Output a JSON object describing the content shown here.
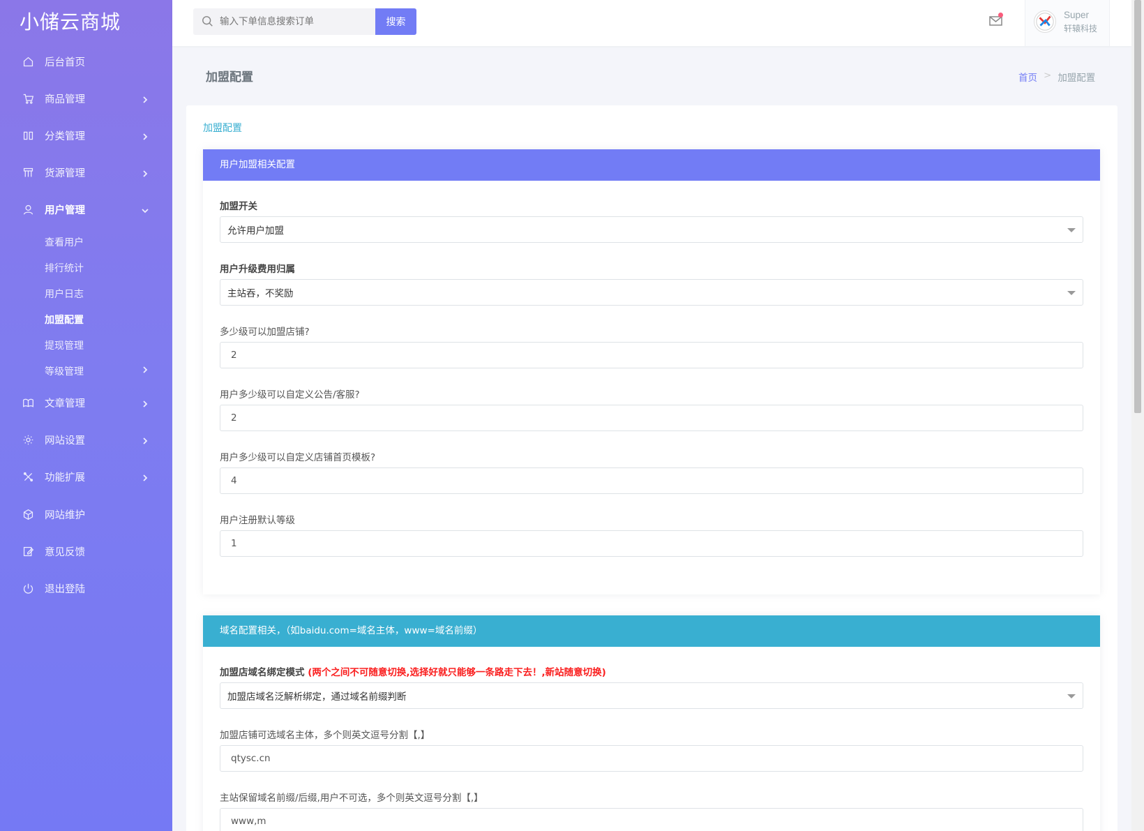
{
  "app": {
    "brand": "小储云商城"
  },
  "sidebar": {
    "items": [
      {
        "label": "后台首页",
        "icon": "home-icon"
      },
      {
        "label": "商品管理",
        "icon": "cart-icon"
      },
      {
        "label": "分类管理",
        "icon": "columns-icon"
      },
      {
        "label": "货源管理",
        "icon": "grid-icon"
      },
      {
        "label": "用户管理",
        "icon": "user-icon"
      },
      {
        "label": "文章管理",
        "icon": "book-icon"
      },
      {
        "label": "网站设置",
        "icon": "gear-icon"
      },
      {
        "label": "功能扩展",
        "icon": "tools-icon"
      },
      {
        "label": "网站维护",
        "icon": "cube-icon"
      },
      {
        "label": "意见反馈",
        "icon": "edit-icon"
      },
      {
        "label": "退出登陆",
        "icon": "power-icon"
      }
    ],
    "subitems": [
      "查看用户",
      "排行统计",
      "用户日志",
      "加盟配置",
      "提现管理",
      "等级管理"
    ]
  },
  "topbar": {
    "search_placeholder": "输入下单信息搜索订单",
    "search_button": "搜索",
    "user_name": "Super",
    "user_org": "轩辕科技"
  },
  "page": {
    "title": "加盟配置",
    "breadcrumb_home": "首页",
    "breadcrumb_sep": ">",
    "breadcrumb_current": "加盟配置"
  },
  "card": {
    "title": "加盟配置",
    "section1": {
      "header": "用户加盟相关配置",
      "fields": [
        {
          "label": "加盟开关",
          "value": "允许用户加盟"
        },
        {
          "label": "用户升级费用归属",
          "value": "主站吞，不奖励"
        },
        {
          "label": "多少级可以加盟店铺?",
          "value": "2"
        },
        {
          "label": "用户多少级可以自定义公告/客服?",
          "value": "2"
        },
        {
          "label": "用户多少级可以自定义店铺首页模板?",
          "value": "4"
        },
        {
          "label": "用户注册默认等级",
          "value": "1"
        }
      ]
    },
    "section2": {
      "header": "域名配置相关，（如baidu.com=域名主体，www=域名前缀）",
      "fields": [
        {
          "label": "加盟店域名绑定模式",
          "warning": "(两个之间不可随意切换,选择好就只能够一条路走下去！,新站随意切换)",
          "value": "加盟店域名泛解析绑定，通过域名前缀判断"
        },
        {
          "label": "加盟店铺可选域名主体，多个则英文逗号分割【,】",
          "value": "qtysc.cn"
        },
        {
          "label": "主站保留域名前缀/后缀,用户不可选，多个则英文逗号分割【,】",
          "value": "www,m"
        }
      ]
    }
  }
}
